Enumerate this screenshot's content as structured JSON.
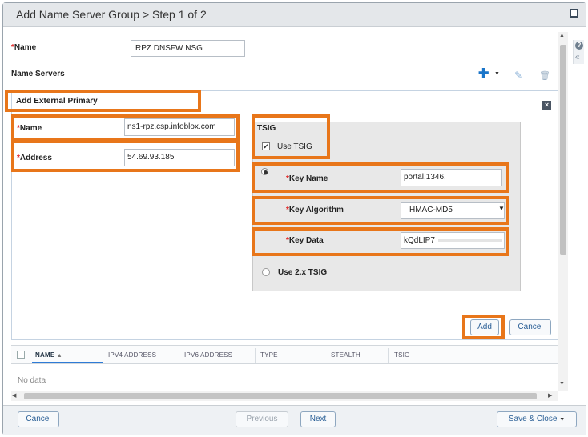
{
  "dialog": {
    "title": "Add Name Server Group > Step 1 of 2"
  },
  "form": {
    "name_label": "Name",
    "name_value": "RPZ DNSFW NSG",
    "name_servers_label": "Name Servers"
  },
  "panel": {
    "title": "Add External Primary",
    "ext_name_label": "Name",
    "ext_name_value": "ns1-rpz.csp.infoblox.com",
    "address_label": "Address",
    "address_value": "54.69.93.185"
  },
  "tsig": {
    "heading": "TSIG",
    "use_tsig_label": "Use TSIG",
    "use_tsig_checked": true,
    "key_name_label": "Key Name",
    "key_name_value": "portal.1346.",
    "key_algorithm_label": "Key Algorithm",
    "key_algorithm_value": "HMAC-MD5",
    "key_data_label": "Key Data",
    "key_data_value": "kQdLIP7",
    "use_2x_label": "Use 2.x TSIG"
  },
  "panel_buttons": {
    "add": "Add",
    "cancel": "Cancel"
  },
  "grid": {
    "columns": [
      "NAME",
      "IPV4 ADDRESS",
      "IPV6 ADDRESS",
      "TYPE",
      "STEALTH",
      "TSIG"
    ],
    "sort_indicator": "▲",
    "empty_text": "No data"
  },
  "footer": {
    "cancel": "Cancel",
    "previous": "Previous",
    "next": "Next",
    "save_close": "Save & Close"
  },
  "colors": {
    "highlight": "#e8761a",
    "required": "#e02020",
    "accent": "#1a75c9"
  }
}
